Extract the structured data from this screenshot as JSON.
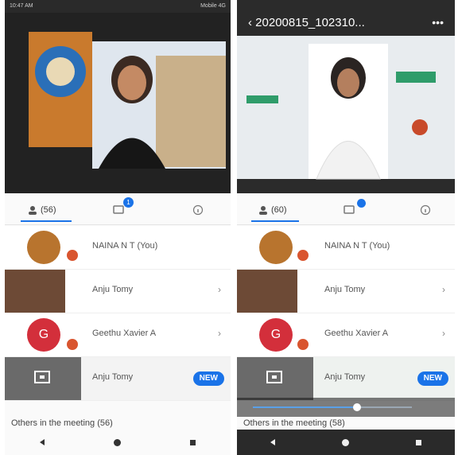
{
  "left_phone": {
    "status_left": "10:47 AM",
    "status_right": "Mobile 4G",
    "participants_tab": "(56)",
    "chat_badge": "1",
    "participants": [
      {
        "name": "NAINA N T (You)",
        "kind": "avatar-photo"
      },
      {
        "name": "Anju Tomy",
        "kind": "video-thumb"
      },
      {
        "name": "Geethu Xavier A",
        "kind": "initial",
        "initial": "G"
      },
      {
        "name": "Anju Tomy",
        "kind": "presentation",
        "badge": "NEW"
      }
    ],
    "others_label": "Others in the meeting (56)"
  },
  "right_phone": {
    "title": "20200815_102310...",
    "participants_tab": "(60)",
    "participants": [
      {
        "name": "NAINA N T (You)",
        "kind": "avatar-photo"
      },
      {
        "name": "Anju Tomy",
        "kind": "video-thumb"
      },
      {
        "name": "Geethu Xavier A",
        "kind": "initial",
        "initial": "G"
      },
      {
        "name": "Anju Tomy",
        "kind": "presentation",
        "badge": "NEW"
      }
    ],
    "others_label": "Others in the meeting (58)"
  },
  "colors": {
    "accent": "#1a73e8",
    "mute": "#d9552f",
    "avatar_red": "#d32f3b"
  },
  "icons": [
    "people-icon",
    "chat-icon",
    "info-icon",
    "chevron-right-icon",
    "present-screen-icon",
    "back-arrow-icon",
    "more-icon"
  ]
}
